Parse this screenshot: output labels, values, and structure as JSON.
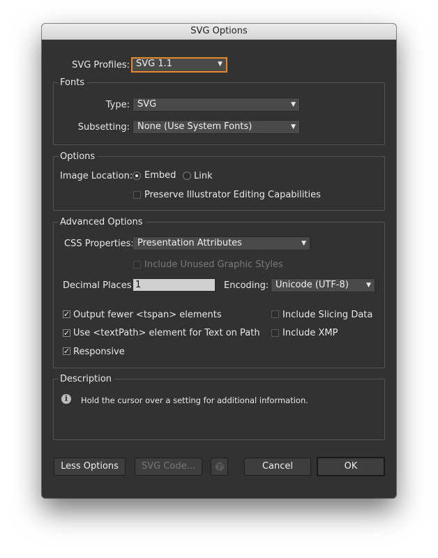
{
  "dialog": {
    "title": "SVG Options"
  },
  "profile": {
    "label": "SVG Profiles:",
    "value": "SVG 1.1"
  },
  "fonts": {
    "title": "Fonts",
    "type_label": "Type:",
    "type_value": "SVG",
    "subsetting_label": "Subsetting:",
    "subsetting_value": "None (Use System Fonts)"
  },
  "options": {
    "title": "Options",
    "image_location_label": "Image Location:",
    "embed_label": "Embed",
    "embed_selected": true,
    "link_label": "Link",
    "preserve_label": "Preserve Illustrator Editing Capabilities",
    "preserve_checked": false
  },
  "advanced": {
    "title": "Advanced Options",
    "css_label": "CSS Properties:",
    "css_value": "Presentation Attributes",
    "unused_styles_label": "Include Unused Graphic Styles",
    "decimal_label": "Decimal Places:",
    "decimal_value": "1",
    "encoding_label": "Encoding:",
    "encoding_value": "Unicode (UTF-8)",
    "fewer_tspan_label": "Output fewer <tspan> elements",
    "fewer_tspan_checked": true,
    "textpath_label": "Use <textPath> element for Text on Path",
    "textpath_checked": true,
    "responsive_label": "Responsive",
    "responsive_checked": true,
    "slicing_label": "Include Slicing Data",
    "slicing_checked": false,
    "xmp_label": "Include XMP",
    "xmp_checked": false
  },
  "description": {
    "title": "Description",
    "text": "Hold the cursor over a setting for additional information."
  },
  "buttons": {
    "less_options": "Less Options",
    "svg_code": "SVG Code...",
    "cancel": "Cancel",
    "ok": "OK"
  },
  "icons": {
    "dropdown_arrow": "▼",
    "check": "✓",
    "info": "i"
  }
}
